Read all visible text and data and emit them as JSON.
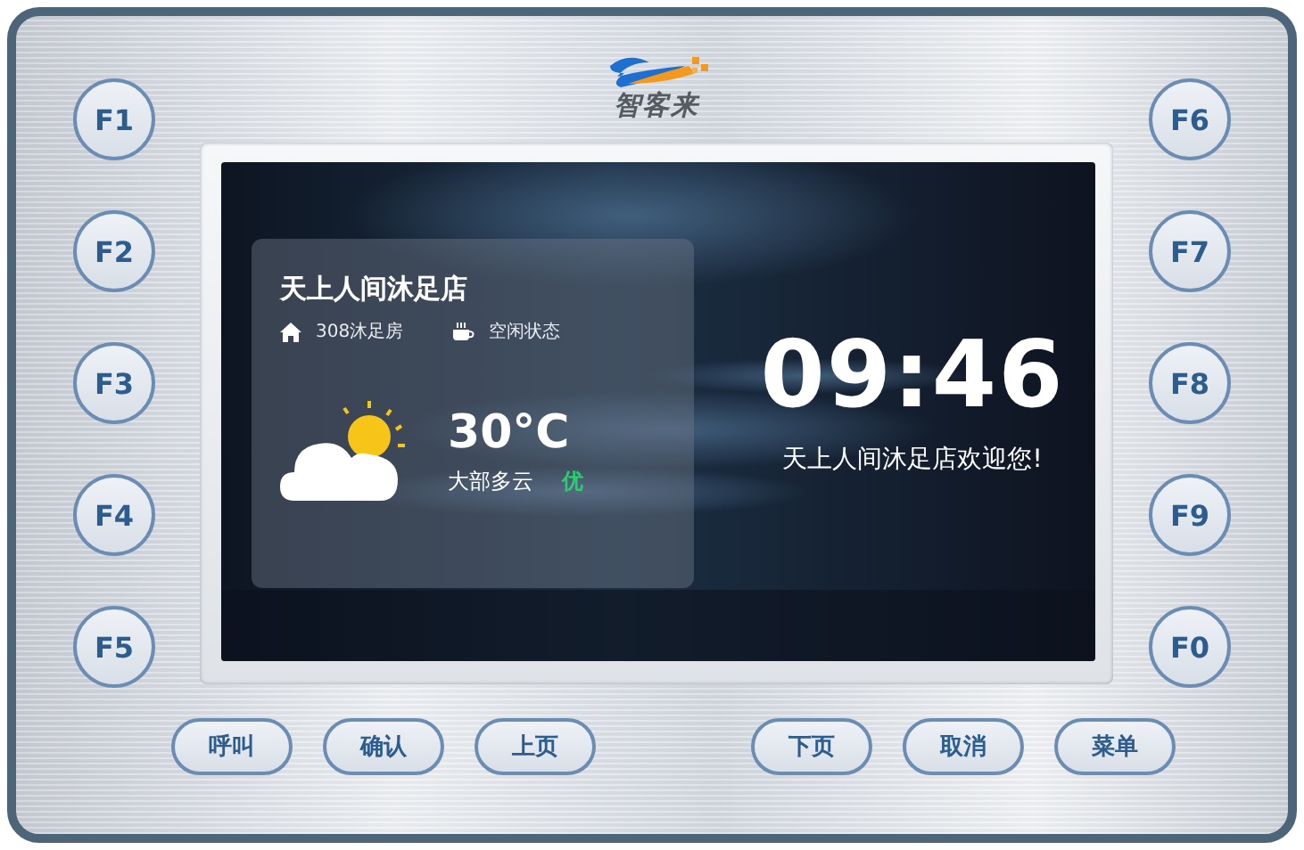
{
  "logo": {
    "text": "智客来"
  },
  "function_keys_left": [
    {
      "label": "F1"
    },
    {
      "label": "F2"
    },
    {
      "label": "F3"
    },
    {
      "label": "F4"
    },
    {
      "label": "F5"
    }
  ],
  "function_keys_right": [
    {
      "label": "F6"
    },
    {
      "label": "F7"
    },
    {
      "label": "F8"
    },
    {
      "label": "F9"
    },
    {
      "label": "F0"
    }
  ],
  "screen": {
    "store_card": {
      "title": "天上人间沐足店",
      "room": "308沐足房",
      "status": "空闲状态",
      "temperature": "30°C",
      "condition": "大部多云",
      "air_quality": "优"
    },
    "clock": {
      "time": "09:46",
      "welcome": "天上人间沐足店欢迎您!"
    }
  },
  "buttons_left": [
    "呼叫",
    "确认",
    "上页"
  ],
  "buttons_right": [
    "下页",
    "取消",
    "菜单"
  ]
}
